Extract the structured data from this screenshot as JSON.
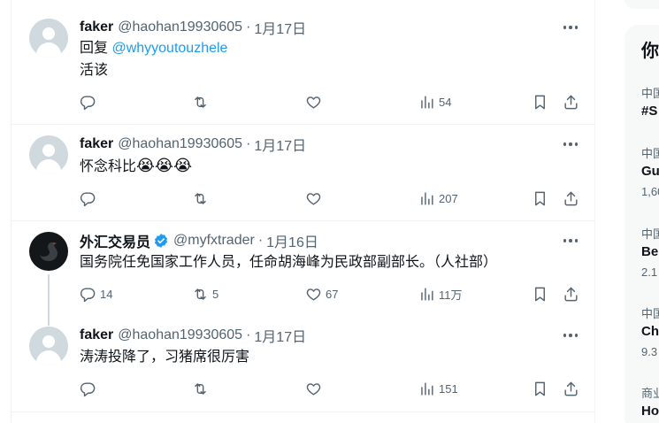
{
  "tweets": [
    {
      "name": "faker",
      "handle": "@haohan19930605",
      "sep": "·",
      "time": "1月17日",
      "reply_prefix": "回复 ",
      "reply_to": "@whyyoutouzhele",
      "text": "活该",
      "stats": {
        "reply": "",
        "retweet": "",
        "like": "",
        "views": "54"
      }
    },
    {
      "name": "faker",
      "handle": "@haohan19930605",
      "sep": "·",
      "time": "1月17日",
      "text": "怀念科比",
      "emoji": "😭😭😭",
      "stats": {
        "reply": "",
        "retweet": "",
        "like": "",
        "views": "207"
      }
    },
    {
      "name": "外汇交易员",
      "handle": "@myfxtrader",
      "sep": "·",
      "time": "1月16日",
      "verified": true,
      "text": "国务院任免国家工作人员，任命胡海峰为民政部副部长。（人社部）",
      "stats": {
        "reply": "14",
        "retweet": "5",
        "like": "67",
        "views": "11万"
      }
    },
    {
      "name": "faker",
      "handle": "@haohan19930605",
      "sep": "·",
      "time": "1月17日",
      "text": "涛涛投降了，习猪席很厉害",
      "stats": {
        "reply": "",
        "retweet": "",
        "like": "",
        "views": "151"
      }
    }
  ],
  "sidebar": {
    "title": "你",
    "trends": [
      {
        "category": "中国",
        "name": "#S",
        "count": ""
      },
      {
        "category": "中国",
        "name": "Gu",
        "count": "1,60"
      },
      {
        "category": "中国",
        "name": "Be",
        "count": "2.1"
      },
      {
        "category": "中国",
        "name": "Ch",
        "count": "9.3"
      },
      {
        "category": "商业",
        "name": "Ho",
        "count": ""
      }
    ]
  },
  "colors": {
    "accent": "#1d9bf0",
    "secondary_text": "#536471",
    "border": "#eff3f4",
    "verified": "#1d9bf0"
  },
  "icons": [
    "reply-icon",
    "retweet-icon",
    "like-icon",
    "views-icon",
    "bookmark-icon",
    "share-icon",
    "more-icon",
    "verified-badge-icon",
    "default-avatar-icon"
  ]
}
